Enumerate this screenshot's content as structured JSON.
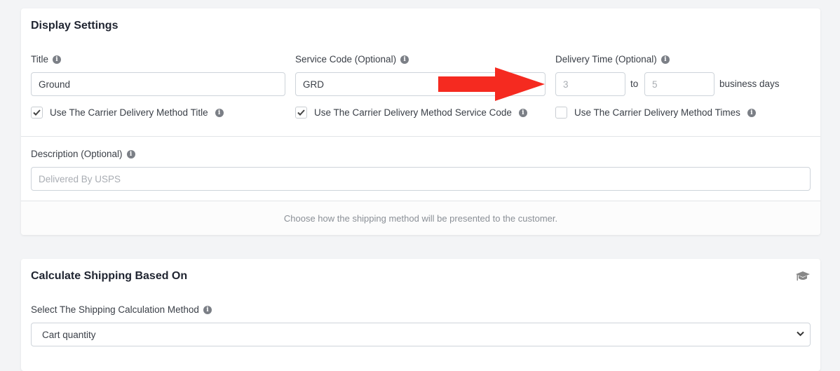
{
  "display_settings": {
    "title": "Display Settings",
    "title_field": {
      "label": "Title",
      "value": "Ground",
      "checkbox_label": "Use The Carrier Delivery Method Title",
      "checkbox_checked": true
    },
    "service_code_field": {
      "label": "Service Code (Optional)",
      "value": "GRD",
      "checkbox_label": "Use The Carrier Delivery Method Service Code",
      "checkbox_checked": true
    },
    "delivery_time_field": {
      "label": "Delivery Time (Optional)",
      "min_placeholder": "3",
      "to_label": "to",
      "max_placeholder": "5",
      "unit_label": "business days",
      "checkbox_label": "Use The Carrier Delivery Method Times",
      "checkbox_checked": false
    },
    "description_field": {
      "label": "Description (Optional)",
      "placeholder": "Delivered By USPS"
    },
    "footer_text": "Choose how the shipping method will be presented to the customer."
  },
  "calculate_shipping": {
    "title": "Calculate Shipping Based On",
    "icon": "graduation-cap-icon",
    "method_field": {
      "label": "Select The Shipping Calculation Method",
      "selected": "Cart quantity"
    }
  },
  "annotation": {
    "arrow_color": "#f52a20",
    "arrow_direction": "right"
  },
  "colors": {
    "background": "#f3f4f6",
    "card": "#ffffff",
    "border": "#ced4da",
    "info_icon": "#7b7f86"
  }
}
